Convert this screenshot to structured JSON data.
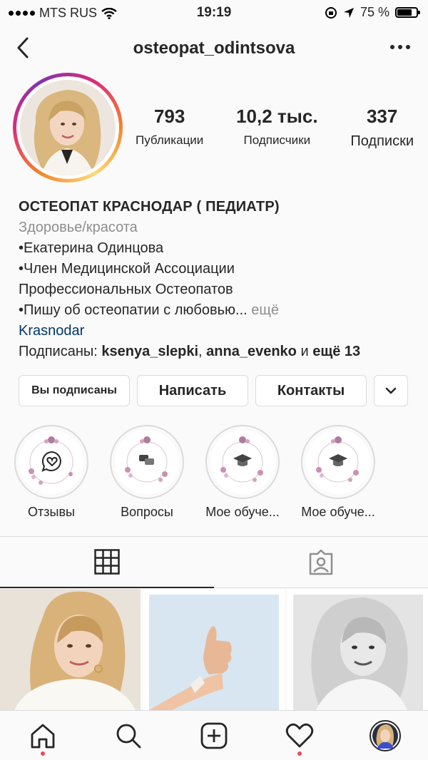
{
  "status_bar": {
    "carrier": "MTS RUS",
    "time": "19:19",
    "battery": "75 %",
    "battery_level": 0.75
  },
  "header": {
    "username": "osteopat_odintsova"
  },
  "stats": [
    {
      "value": "793",
      "label": "Публикации"
    },
    {
      "value": "10,2 тыс.",
      "label": "Подписчики"
    },
    {
      "value": "337",
      "label": "Подписки"
    }
  ],
  "bio": {
    "name": "ОСТЕОПАТ КРАСНОДАР ( ПЕДИАТР)",
    "category": "Здоровье/красота",
    "line1": "•Екатерина Одинцова",
    "line2": "•Член Медицинской Ассоциации",
    "line3": "Профессиональных Остеопатов",
    "line4": "•Пишу об остеопатии с любовью...",
    "more": "ещё",
    "location": "Krasnodar",
    "followed_prefix": "Подписаны: ",
    "followed_user1": "ksenya_slepki",
    "followed_sep": ", ",
    "followed_user2": "anna_evenko",
    "followed_and": " и ",
    "followed_more": "ещё 13"
  },
  "buttons": {
    "following": "Вы подписаны",
    "message": "Написать",
    "contacts": "Контакты"
  },
  "highlights": [
    {
      "label": "Отзывы",
      "icon": "heart-chat-icon"
    },
    {
      "label": "Вопросы",
      "icon": "chat-bubbles-icon"
    },
    {
      "label": "Мое обуче...",
      "icon": "graduation-cap-icon"
    },
    {
      "label": "Мое обуче...",
      "icon": "graduation-cap-icon"
    }
  ],
  "tabs": [
    {
      "icon": "grid-icon"
    },
    {
      "icon": "tagged-icon"
    }
  ],
  "nav": [
    {
      "icon": "home-icon"
    },
    {
      "icon": "search-icon"
    },
    {
      "icon": "add-icon"
    },
    {
      "icon": "heart-icon"
    },
    {
      "icon": "profile-avatar"
    }
  ],
  "colors": {
    "link": "#00376b",
    "notification_dot": "#ed4956"
  }
}
